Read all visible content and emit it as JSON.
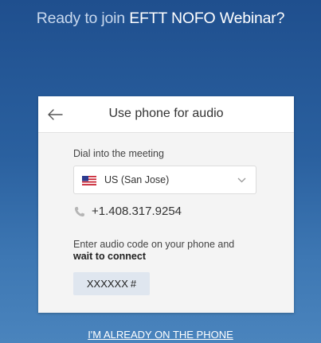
{
  "heading": {
    "lead": "Ready to join",
    "meeting_name": "EFTT NOFO Webinar?"
  },
  "card": {
    "title": "Use phone for audio",
    "back_icon": "arrow-left-icon",
    "dial_label": "Dial into the meeting",
    "country": {
      "flag_icon": "us-flag-icon",
      "selected": "US (San Jose)",
      "chevron_icon": "chevron-down-icon"
    },
    "phone_icon": "phone-icon",
    "phone_number": "+1.408.317.9254",
    "instruction": "Enter audio code on your phone and",
    "instruction_bold": "wait to connect",
    "code": "XXXXXX",
    "code_suffix": "#"
  },
  "already_on_phone": "I'M ALREADY ON THE PHONE",
  "colors": {
    "background_top": "#1f4f8e",
    "background_bottom": "#4a84bd",
    "code_box": "#dfe6ef"
  }
}
